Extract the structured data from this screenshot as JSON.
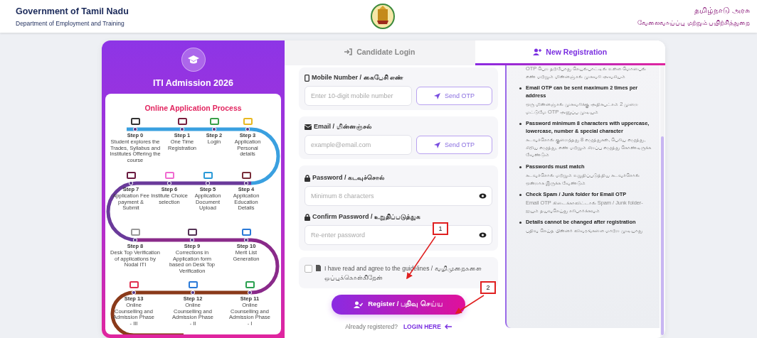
{
  "header": {
    "title": "Government of Tamil Nadu",
    "subtitle": "Department of Employment and Training",
    "title_ta": "தமிழ்நாடு அரசு",
    "subtitle_ta": "வேலைவாய்ப்பு மற்றும் பயிற்சித்துறை"
  },
  "promo": {
    "title": "ITI Admission 2026",
    "process_title": "Online Application Process",
    "steps": [
      {
        "label": "Step 0",
        "text": "Student explores the Trades, Syllabus and Institutes Offering the course"
      },
      {
        "label": "Step 1",
        "text": "One Time Registration"
      },
      {
        "label": "Step 2",
        "text": "Login"
      },
      {
        "label": "Step 3",
        "text": "Application Personal details"
      },
      {
        "label": "Step 7",
        "text": "Application Fee payment & Submit"
      },
      {
        "label": "Step 6",
        "text": "Institute Choice selection"
      },
      {
        "label": "Step 5",
        "text": "Application Document Upload"
      },
      {
        "label": "Step 4",
        "text": "Application Education Details"
      },
      {
        "label": "Step 8",
        "text": "Desk Top Verification of applications by Nodal ITI"
      },
      {
        "label": "Step 9",
        "text": "Corrections in Application form based on Desk Top Verification"
      },
      {
        "label": "Step 10",
        "text": "Merit List Generation"
      },
      {
        "label": "Step 13",
        "text": "Online Counselling and Admission Phase - III"
      },
      {
        "label": "Step 12",
        "text": "Online Counselling and Admission Phase - II"
      },
      {
        "label": "Step 11",
        "text": "Online Counselling and Admission Phase - I"
      }
    ]
  },
  "tabs": [
    {
      "label": "Candidate Login",
      "selected": false
    },
    {
      "label": "New Registration",
      "selected": true
    }
  ],
  "form": {
    "fields": [
      {
        "kind": "phone",
        "label": "Mobile Number / கைபேசி எண்",
        "placeholder": "Enter 10-digit mobile number",
        "button": "Send OTP"
      },
      {
        "kind": "email",
        "label": "Email / மின்னஞ்சல்",
        "placeholder": "example@email.com",
        "button": "Send OTP"
      },
      {
        "kind": "password",
        "label": "Password / கடவுச்சொல்",
        "placeholder": "Minimum 8 characters"
      },
      {
        "kind": "password",
        "label": "Confirm Password / உறுதிப்படுத்துக",
        "placeholder": "Re-enter password"
      }
    ],
    "agreement": {
      "text": "I have read and agree to the guidelines / வழிமுறைகளை ஒப்புக்கொள்கிறேன்",
      "checked": false
    },
    "submit": "Register / பதிவு செய்ய",
    "login_prompt": "Already registered?",
    "login_link": "LOGIN HERE"
  },
  "guidelines": [
    {
      "text": "OTP பெற தற்போது செயல்பாட்டில் உள்ள மொபைல் எண் மற்றும் மின்னஞ்சல் முகவரி அவசியம்"
    },
    {
      "title": "Email OTP can be sent maximum 2 times per address",
      "text": "ஒரு மின்னஞ்சல் முகவரிக்கு அதிகபட்சம் 2 முறை மட்டுமே OTP அனுப்ப முடியும்"
    },
    {
      "title": "Password minimum 8 characters with uppercase, lowercase, number & special character",
      "text": "கடவுச்சொல் குறைந்தது 8 எழுத்துகள், பெரிய எழுத்து, சிறிய எழுத்து, எண் மற்றும் சிறப்பு எழுத்து கொண்டிருக்க வேண்டும்"
    },
    {
      "title": "Passwords must match",
      "text": "கடவுச்சொல் மற்றும் உறுதிப்படுத்திய கடவுச்சொல் ஒன்றாக இருக்க வேண்டும்"
    },
    {
      "title": "Check Spam / Junk folder for Email OTP",
      "text": "Email OTP கிடைக்காவிட்டால் Spam / Junk folder-ஐயும் தயவுசெய்து சரிபார்க்கவும்"
    },
    {
      "title": "Details cannot be changed after registration",
      "text": "பதிவு செய்த பின்னர் விவரங்களை மாற்ற முடியாது"
    }
  ],
  "annotations": [
    {
      "label": "1"
    },
    {
      "label": "2"
    }
  ]
}
